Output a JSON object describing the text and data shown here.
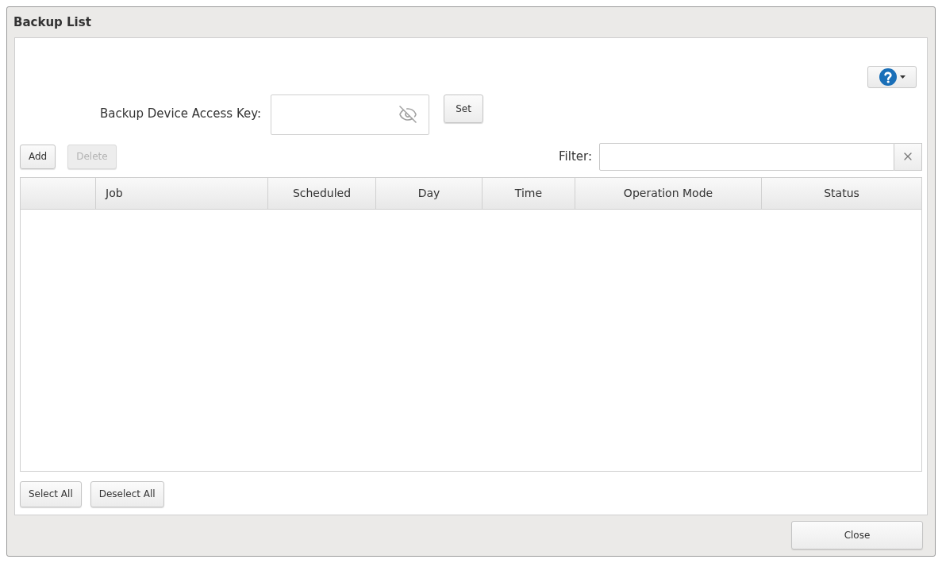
{
  "window": {
    "title": "Backup List"
  },
  "access_key": {
    "label": "Backup Device Access Key:",
    "visible": false,
    "set_button": "Set"
  },
  "toolbar": {
    "buttons": [
      {
        "label": "Add",
        "disabled": false
      },
      {
        "label": "Delete",
        "disabled": true
      }
    ]
  },
  "filter": {
    "label": "Filter:"
  },
  "table": {
    "columns": [
      "Job",
      "Scheduled",
      "Day",
      "Time",
      "Operation Mode",
      "Status"
    ]
  },
  "selection_buttons": [
    "Select All",
    "Deselect All"
  ],
  "footer": {
    "close_button": "Close"
  }
}
